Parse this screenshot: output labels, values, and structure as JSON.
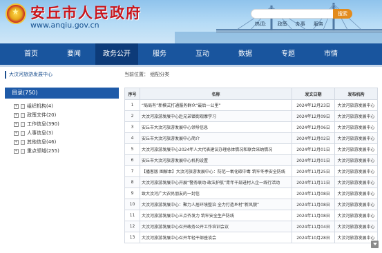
{
  "header": {
    "title": "安丘市人民政府",
    "url": "www.anqiu.gov.cn",
    "search_button": "搜索",
    "links": {
      "hot": "热词:",
      "items": [
        "政策",
        "办事",
        "服务"
      ]
    }
  },
  "nav": {
    "items": [
      "首页",
      "要闻",
      "政务公开",
      "服务",
      "互动",
      "数据",
      "专题",
      "市情"
    ],
    "active_index": 2
  },
  "sidebar": {
    "title": "大汶河旅游发展中心",
    "catalog": "目录(750)",
    "items": [
      {
        "label": "组织机构(4)"
      },
      {
        "label": "政策文件(20)"
      },
      {
        "label": "工作信息(390)"
      },
      {
        "label": "人事信息(3)"
      },
      {
        "label": "其他信息(46)"
      },
      {
        "label": "重点领域(255)"
      }
    ]
  },
  "main": {
    "breadcrumb": "当前位置： 组配分类",
    "columns": [
      "序号",
      "名称",
      "发文日期",
      "发布机构"
    ],
    "rows": [
      {
        "no": "1",
        "name": "“局局有”新模式打通服务群众“最后一公里”",
        "date": "2024年12月23日",
        "org": "大汶河旅游发展中心"
      },
      {
        "no": "2",
        "name": "大汶河旅游发展中心赴兄弟镇街观摩学习",
        "date": "2024年12月09日",
        "org": "大汶河旅游发展中心"
      },
      {
        "no": "3",
        "name": "安丘市大汶河旅游发展中心领导信息",
        "date": "2024年12月06日",
        "org": "大汶河旅游发展中心"
      },
      {
        "no": "4",
        "name": "安丘市大汶河旅游发展中心简介",
        "date": "2024年12月02日",
        "org": "大汶河旅游发展中心"
      },
      {
        "no": "5",
        "name": "大汶河旅游发展中心2024年人大代表建议办理总体情况和联合采纳情况",
        "date": "2024年12月01日",
        "org": "大汶河旅游发展中心"
      },
      {
        "no": "6",
        "name": "安丘市大汶河旅游发展中心机构设置",
        "date": "2024年12月01日",
        "org": "大汶河旅游发展中心"
      },
      {
        "no": "7",
        "name": "【播客版 图解本】大汶河旅游发展中心：防范一氧化碳中毒 筑牢冬季安全防线",
        "date": "2024年11月25日",
        "org": "大汶河旅游发展中心"
      },
      {
        "no": "8",
        "name": "大汶河旅游发展中心开展“警务联动·政法护航”青年干部进村入企一线行活动",
        "date": "2024年11月11日",
        "org": "大汶河旅游发展中心"
      },
      {
        "no": "9",
        "name": "致大汶河广大农民朋友的一封信",
        "date": "2024年11月08日",
        "org": "大汶河旅游发展中心"
      },
      {
        "no": "10",
        "name": "大汶河旅游发展中心：聚力人居环境整治 全力打造乡村“新风貌”",
        "date": "2024年11月08日",
        "org": "大汶河旅游发展中心"
      },
      {
        "no": "11",
        "name": "大汶河旅游发展中心三点齐发力 筑牢安全生产防线",
        "date": "2024年11月08日",
        "org": "大汶河旅游发展中心"
      },
      {
        "no": "12",
        "name": "大汶河旅游发展中心召开政务公开工作培训会议",
        "date": "2024年11月04日",
        "org": "大汶河旅游发展中心"
      },
      {
        "no": "13",
        "name": "大汶河旅游发展中心召开年轻干部座谈会",
        "date": "2024年10月28日",
        "org": "大汶河旅游发展中心"
      }
    ]
  },
  "colors": {
    "nav": "#19559e",
    "nav_active": "#0d3b79",
    "title": "#c8161d",
    "search_button": "#e38b1c"
  }
}
